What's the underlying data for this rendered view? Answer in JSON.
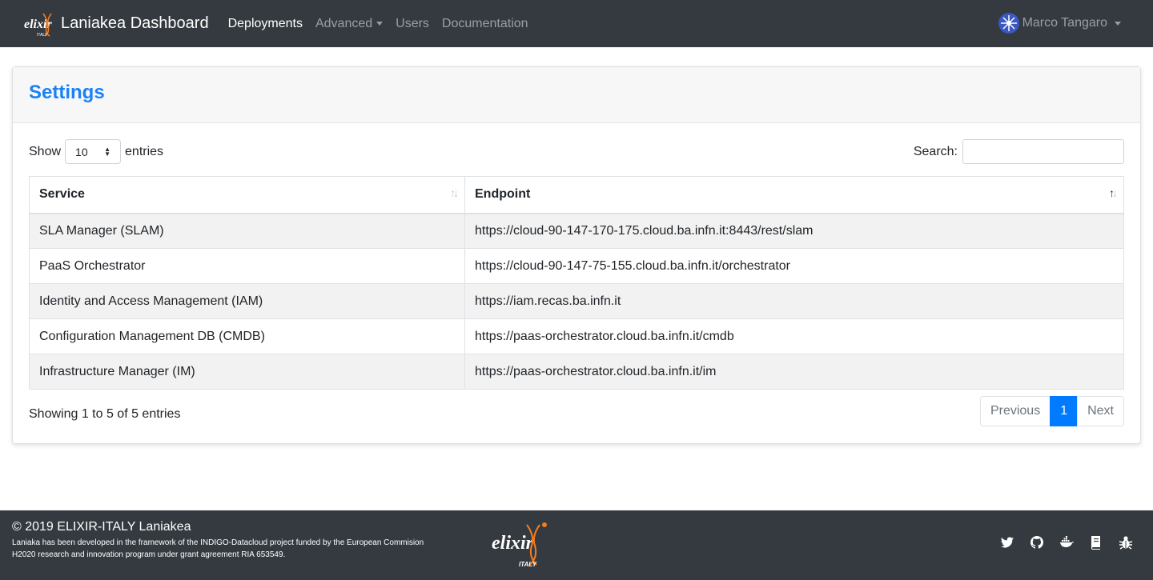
{
  "navbar": {
    "brand_title": "Laniakea Dashboard",
    "links": [
      {
        "label": "Deployments",
        "active": true
      },
      {
        "label": "Advanced",
        "dropdown": true
      },
      {
        "label": "Users"
      },
      {
        "label": "Documentation"
      }
    ],
    "user_name": "Marco Tangaro"
  },
  "card": {
    "title": "Settings",
    "length": {
      "label_before": "Show",
      "value": "10",
      "label_after": "entries"
    },
    "search_label": "Search:",
    "columns": [
      "Service",
      "Endpoint"
    ],
    "rows": [
      [
        "SLA Manager (SLAM)",
        "https://cloud-90-147-170-175.cloud.ba.infn.it:8443/rest/slam"
      ],
      [
        "PaaS Orchestrator",
        "https://cloud-90-147-75-155.cloud.ba.infn.it/orchestrator"
      ],
      [
        "Identity and Access Management (IAM)",
        "https://iam.recas.ba.infn.it"
      ],
      [
        "Configuration Management DB (CMDB)",
        "https://paas-orchestrator.cloud.ba.infn.it/cmdb"
      ],
      [
        "Infrastructure Manager (IM)",
        "https://paas-orchestrator.cloud.ba.infn.it/im"
      ]
    ],
    "info": "Showing 1 to 5 of 5 entries",
    "pagination": {
      "previous": "Previous",
      "current": "1",
      "next": "Next"
    }
  },
  "footer": {
    "title": "© 2019 ELIXIR-ITALY Laniakea",
    "text_line1": "Laniaka has been developed in the framework of the INDIGO-Datacloud project funded by the European Commision",
    "text_line2": "H2020 research and innovation program under grant agreement RIA 653549.",
    "icons": [
      "twitter-icon",
      "github-icon",
      "docker-icon",
      "book-icon",
      "bug-icon"
    ]
  },
  "colors": {
    "navbar": "#343a40",
    "accent": "#1a82f7",
    "primary": "#007bff",
    "logo_orange": "#f47d20"
  }
}
